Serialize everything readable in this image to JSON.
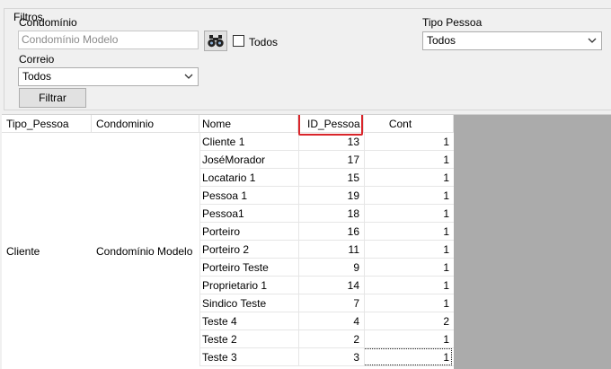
{
  "filters": {
    "title": "Filtros",
    "condominio_label": "Condomínio",
    "condominio_value": "Condomínio Modelo",
    "todos_label": "Todos",
    "tipo_pessoa_label": "Tipo Pessoa",
    "tipo_pessoa_value": "Todos",
    "correio_label": "Correio",
    "correio_value": "Todos",
    "filtrar_label": "Filtrar",
    "search_icon": "binoculars-icon"
  },
  "grid": {
    "columns": [
      "Tipo_Pessoa",
      "Condominio",
      "Nome",
      "ID_Pessoa",
      "Cont"
    ],
    "group": {
      "tipo_pessoa": "Cliente",
      "condominio": "Condomínio Modelo"
    },
    "rows": [
      {
        "nome": "Cliente 1",
        "id": "13",
        "cont": "1"
      },
      {
        "nome": "JoséMorador",
        "id": "17",
        "cont": "1"
      },
      {
        "nome": "Locatario 1",
        "id": "15",
        "cont": "1"
      },
      {
        "nome": "Pessoa 1",
        "id": "19",
        "cont": "1"
      },
      {
        "nome": "Pessoa1",
        "id": "18",
        "cont": "1"
      },
      {
        "nome": "Porteiro",
        "id": "16",
        "cont": "1"
      },
      {
        "nome": "Porteiro 2",
        "id": "11",
        "cont": "1"
      },
      {
        "nome": "Porteiro Teste",
        "id": "9",
        "cont": "1"
      },
      {
        "nome": "Proprietario 1",
        "id": "14",
        "cont": "1"
      },
      {
        "nome": "Sindico Teste",
        "id": "7",
        "cont": "1"
      },
      {
        "nome": "Teste  4",
        "id": "4",
        "cont": "2"
      },
      {
        "nome": "Teste 2",
        "id": "2",
        "cont": "1"
      },
      {
        "nome": "Teste 3",
        "id": "3",
        "cont": "1"
      }
    ],
    "highlight_color": "#d9252a"
  }
}
